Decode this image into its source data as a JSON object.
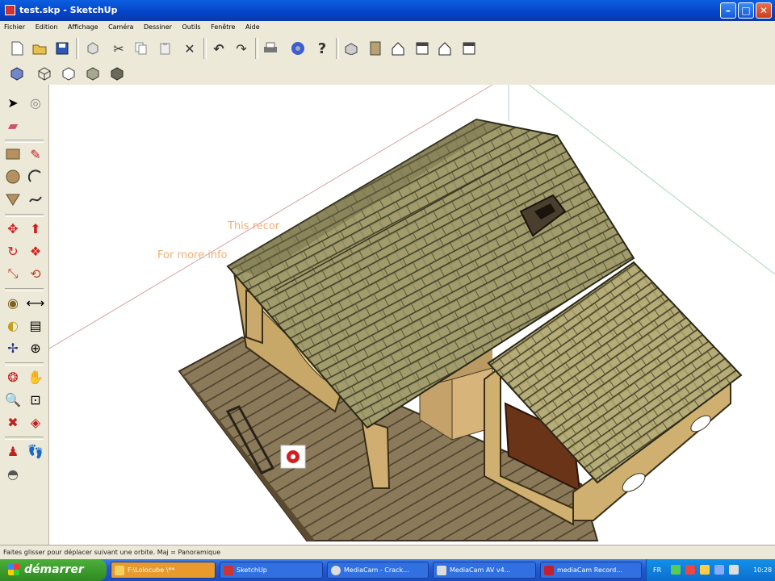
{
  "window": {
    "title": "test.skp - SketchUp"
  },
  "menu": [
    "Fichier",
    "Edition",
    "Affichage",
    "Caméra",
    "Dessiner",
    "Outils",
    "Fenêtre",
    "Aide"
  ],
  "toolbar1": [
    "new-icon",
    "open-icon",
    "save-icon",
    "make-component-icon",
    "cut-icon",
    "copy-icon",
    "paste-icon",
    "erase-icon",
    "undo-icon",
    "redo-icon",
    "print-icon",
    "model-info-icon",
    "help-icon",
    "iso-view-icon",
    "top-view-icon",
    "front-view-icon",
    "right-view-icon",
    "back-view-icon",
    "left-view-icon"
  ],
  "toolbar2": [
    "xray-icon",
    "wireframe-icon",
    "hidden-line-icon",
    "shaded-icon",
    "shaded-texture-icon"
  ],
  "left_tools": [
    "select-icon",
    "component-icon",
    "eraser-icon",
    "paint-bucket-icon",
    "rectangle-icon",
    "pencil-icon",
    "circle-icon",
    "arc-icon",
    "polygon-icon",
    "freehand-icon",
    "move-icon",
    "pushpull-icon",
    "rotate-icon",
    "followme-icon",
    "scale-icon",
    "offset-icon",
    "tape-measure-icon",
    "dimension-icon",
    "protractor-icon",
    "text-icon",
    "axes-icon",
    "3d-text-icon",
    "orbit-icon",
    "pan-icon",
    "zoom-icon",
    "zoom-window-icon",
    "zoom-extents-icon",
    "previous-view-icon",
    "position-camera-icon",
    "walk-icon",
    "section-plane-icon"
  ],
  "viewport": {
    "overlay_line1": "This recor",
    "overlay_line2": "For more info"
  },
  "status": {
    "text": "Faites glisser pour déplacer suivant une orbite. Maj = Panoramique"
  },
  "taskbar": {
    "start": "démarrer",
    "tasks": [
      {
        "label": "F:\\Lolocube \\**",
        "color": "#e89a2c"
      },
      {
        "label": "SketchUp",
        "color": "#2a64d8"
      },
      {
        "label": "MediaCam - Crack...",
        "color": "#2a64d8"
      },
      {
        "label": "MediaCam AV v4...",
        "color": "#2a64d8"
      },
      {
        "label": "mediaCam Record...",
        "color": "#2a64d8"
      }
    ],
    "lang": "FR",
    "time": "10:28"
  },
  "colors": {
    "title_blue": "#0543c8",
    "roof": "#8e8a5e",
    "wood": "#a58a56",
    "deck": "#7a6a4e"
  }
}
